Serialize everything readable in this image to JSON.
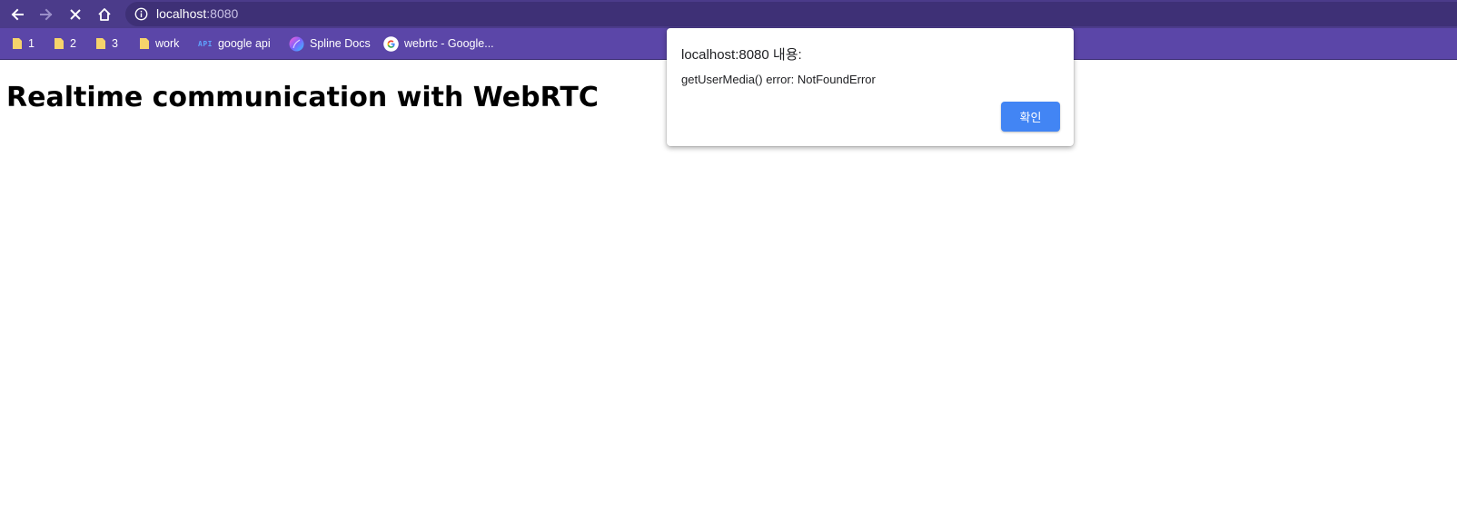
{
  "browser": {
    "url_host": "localhost",
    "url_port": ":8080",
    "toolbar_color": "#4b3b8a",
    "bookmarks_bar_color": "#5b46a8",
    "bookmarks": [
      {
        "label": "1",
        "icon": "folder-icon"
      },
      {
        "label": "2",
        "icon": "folder-icon"
      },
      {
        "label": "3",
        "icon": "folder-icon"
      },
      {
        "label": "work",
        "icon": "folder-icon"
      },
      {
        "label": "google api",
        "icon": "api-icon",
        "icon_text": "API"
      },
      {
        "label": "Spline Docs",
        "icon": "spline-logo-icon"
      },
      {
        "label": "webrtc - Google...",
        "icon": "google-logo-icon"
      }
    ]
  },
  "page": {
    "title": "Realtime communication with WebRTC"
  },
  "dialog": {
    "title": "localhost:8080 내용:",
    "message": "getUserMedia() error: NotFoundError",
    "ok_label": "확인",
    "ok_color": "#4285f4"
  }
}
